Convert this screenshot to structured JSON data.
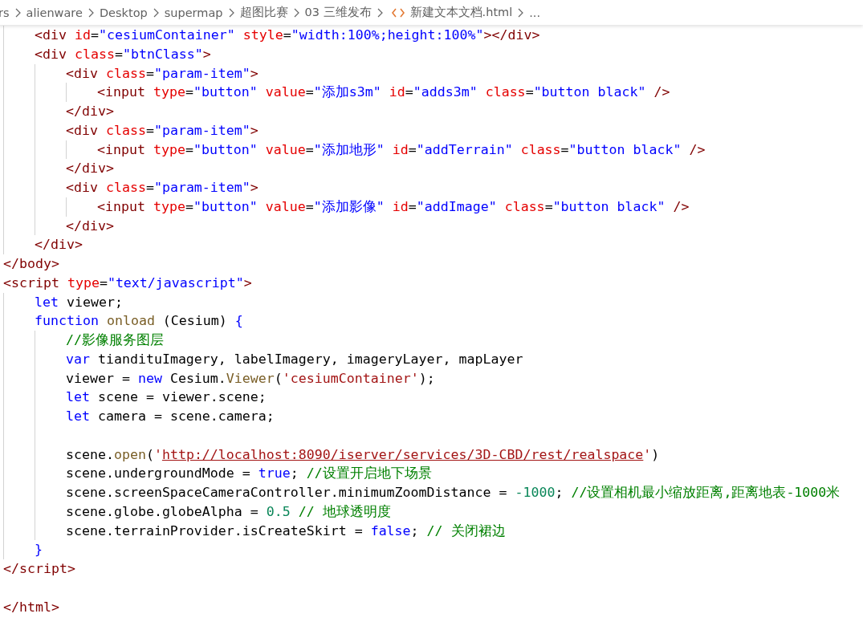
{
  "breadcrumb": [
    {
      "label": "rs",
      "kind": "folder"
    },
    {
      "label": "alienware",
      "kind": "folder"
    },
    {
      "label": "Desktop",
      "kind": "folder"
    },
    {
      "label": "supermap",
      "kind": "folder"
    },
    {
      "label": "超图比赛",
      "kind": "folder"
    },
    {
      "label": "03 三维发布",
      "kind": "folder"
    },
    {
      "label": "新建文本文档.html",
      "kind": "file"
    },
    {
      "label": "...",
      "kind": "more"
    }
  ],
  "code": [
    {
      "kind": "hidden",
      "children": [
        {
          "kind": "code",
          "tokens": [
            {
              "text": "<div",
              "kind": "tag"
            },
            {
              "text": " id",
              "kind": "attr"
            },
            {
              "text": "=",
              "kind": "plain"
            },
            {
              "text": "\"cesiumContainer\"",
              "kind": "value"
            },
            {
              "text": " style",
              "kind": "attr"
            },
            {
              "text": "=",
              "kind": "plain"
            },
            {
              "text": "\"width:100%;height:100%\"",
              "kind": "value"
            },
            {
              "text": "></div>",
              "kind": "tag"
            }
          ]
        },
        {
          "kind": "code",
          "tokens": [
            {
              "text": "<div",
              "kind": "tag"
            },
            {
              "text": " class",
              "kind": "attr"
            },
            {
              "text": "=",
              "kind": "plain"
            },
            {
              "text": "\"btnClass\"",
              "kind": "value"
            },
            {
              "text": ">",
              "kind": "tag"
            }
          ],
          "children": [
            {
              "kind": "code",
              "tokens": [
                {
                  "text": "<div",
                  "kind": "tag"
                },
                {
                  "text": " class",
                  "kind": "attr"
                },
                {
                  "text": "=",
                  "kind": "plain"
                },
                {
                  "text": "\"param-item\"",
                  "kind": "value"
                },
                {
                  "text": ">",
                  "kind": "tag"
                }
              ],
              "children": [
                {
                  "kind": "code",
                  "tokens": [
                    {
                      "text": "<input",
                      "kind": "tag"
                    },
                    {
                      "text": " type",
                      "kind": "attr"
                    },
                    {
                      "text": "=",
                      "kind": "plain"
                    },
                    {
                      "text": "\"button\"",
                      "kind": "value"
                    },
                    {
                      "text": " value",
                      "kind": "attr"
                    },
                    {
                      "text": "=",
                      "kind": "plain"
                    },
                    {
                      "text": "\"添加s3m\"",
                      "kind": "value"
                    },
                    {
                      "text": " id",
                      "kind": "attr"
                    },
                    {
                      "text": "=",
                      "kind": "plain"
                    },
                    {
                      "text": "\"adds3m\"",
                      "kind": "value"
                    },
                    {
                      "text": " class",
                      "kind": "attr"
                    },
                    {
                      "text": "=",
                      "kind": "plain"
                    },
                    {
                      "text": "\"button black\"",
                      "kind": "value"
                    },
                    {
                      "text": " />",
                      "kind": "tag"
                    }
                  ]
                }
              ]
            },
            {
              "kind": "code",
              "tokens": [
                {
                  "text": "</div>",
                  "kind": "tag"
                }
              ]
            },
            {
              "kind": "code",
              "tokens": [
                {
                  "text": "<div",
                  "kind": "tag"
                },
                {
                  "text": " class",
                  "kind": "attr"
                },
                {
                  "text": "=",
                  "kind": "plain"
                },
                {
                  "text": "\"param-item\"",
                  "kind": "value"
                },
                {
                  "text": ">",
                  "kind": "tag"
                }
              ],
              "children": [
                {
                  "kind": "code",
                  "tokens": [
                    {
                      "text": "<input",
                      "kind": "tag"
                    },
                    {
                      "text": " type",
                      "kind": "attr"
                    },
                    {
                      "text": "=",
                      "kind": "plain"
                    },
                    {
                      "text": "\"button\"",
                      "kind": "value"
                    },
                    {
                      "text": " value",
                      "kind": "attr"
                    },
                    {
                      "text": "=",
                      "kind": "plain"
                    },
                    {
                      "text": "\"添加地形\"",
                      "kind": "value"
                    },
                    {
                      "text": " id",
                      "kind": "attr"
                    },
                    {
                      "text": "=",
                      "kind": "plain"
                    },
                    {
                      "text": "\"addTerrain\"",
                      "kind": "value"
                    },
                    {
                      "text": " class",
                      "kind": "attr"
                    },
                    {
                      "text": "=",
                      "kind": "plain"
                    },
                    {
                      "text": "\"button black\"",
                      "kind": "value"
                    },
                    {
                      "text": " />",
                      "kind": "tag"
                    }
                  ]
                }
              ]
            },
            {
              "kind": "code",
              "tokens": [
                {
                  "text": "</div>",
                  "kind": "tag"
                }
              ]
            },
            {
              "kind": "code",
              "tokens": [
                {
                  "text": "<div",
                  "kind": "tag"
                },
                {
                  "text": " class",
                  "kind": "attr"
                },
                {
                  "text": "=",
                  "kind": "plain"
                },
                {
                  "text": "\"param-item\"",
                  "kind": "value"
                },
                {
                  "text": ">",
                  "kind": "tag"
                }
              ],
              "children": [
                {
                  "kind": "code",
                  "tokens": [
                    {
                      "text": "<input",
                      "kind": "tag"
                    },
                    {
                      "text": " type",
                      "kind": "attr"
                    },
                    {
                      "text": "=",
                      "kind": "plain"
                    },
                    {
                      "text": "\"button\"",
                      "kind": "value"
                    },
                    {
                      "text": " value",
                      "kind": "attr"
                    },
                    {
                      "text": "=",
                      "kind": "plain"
                    },
                    {
                      "text": "\"添加影像\"",
                      "kind": "value"
                    },
                    {
                      "text": " id",
                      "kind": "attr"
                    },
                    {
                      "text": "=",
                      "kind": "plain"
                    },
                    {
                      "text": "\"addImage\"",
                      "kind": "value"
                    },
                    {
                      "text": " class",
                      "kind": "attr"
                    },
                    {
                      "text": "=",
                      "kind": "plain"
                    },
                    {
                      "text": "\"button black\"",
                      "kind": "value"
                    },
                    {
                      "text": " />",
                      "kind": "tag"
                    }
                  ]
                }
              ]
            },
            {
              "kind": "code",
              "tokens": [
                {
                  "text": "</div>",
                  "kind": "tag"
                }
              ]
            }
          ]
        },
        {
          "kind": "code",
          "tokens": [
            {
              "text": "</div>",
              "kind": "tag"
            }
          ]
        }
      ]
    },
    {
      "kind": "code",
      "tokens": [
        {
          "text": "</body>",
          "kind": "tag"
        }
      ]
    },
    {
      "kind": "code",
      "tokens": [
        {
          "text": "<script",
          "kind": "tag"
        },
        {
          "text": " type",
          "kind": "attr"
        },
        {
          "text": "=",
          "kind": "plain"
        },
        {
          "text": "\"text/javascript\"",
          "kind": "value"
        },
        {
          "text": ">",
          "kind": "tag"
        }
      ],
      "children": [
        {
          "kind": "code",
          "tokens": [
            {
              "text": "let",
              "kind": "keyword"
            },
            {
              "text": " viewer;",
              "kind": "plain"
            }
          ]
        },
        {
          "kind": "code",
          "tokens": [
            {
              "text": "function",
              "kind": "keyword"
            },
            {
              "text": " onload",
              "kind": "function"
            },
            {
              "text": " (Cesium) ",
              "kind": "plain"
            },
            {
              "text": "{",
              "kind": "keyword"
            }
          ],
          "children": [
            {
              "kind": "code",
              "tokens": [
                {
                  "text": "//影像服务图层",
                  "kind": "comment"
                }
              ]
            },
            {
              "kind": "code",
              "tokens": [
                {
                  "text": "var",
                  "kind": "keyword"
                },
                {
                  "text": " tiandituImagery, labelImagery, imageryLayer, mapLayer",
                  "kind": "plain"
                }
              ]
            },
            {
              "kind": "code",
              "tokens": [
                {
                  "text": "viewer = ",
                  "kind": "plain"
                },
                {
                  "text": "new",
                  "kind": "keyword"
                },
                {
                  "text": " Cesium.",
                  "kind": "plain"
                },
                {
                  "text": "Viewer",
                  "kind": "function"
                },
                {
                  "text": "(",
                  "kind": "plain"
                },
                {
                  "text": "'cesiumContainer'",
                  "kind": "string"
                },
                {
                  "text": ");",
                  "kind": "plain"
                }
              ]
            },
            {
              "kind": "code",
              "tokens": [
                {
                  "text": "let",
                  "kind": "keyword"
                },
                {
                  "text": " scene = viewer.scene;",
                  "kind": "plain"
                }
              ]
            },
            {
              "kind": "code",
              "tokens": [
                {
                  "text": "let",
                  "kind": "keyword"
                },
                {
                  "text": " camera = scene.camera;",
                  "kind": "plain"
                }
              ]
            },
            {
              "kind": "blank"
            },
            {
              "kind": "code",
              "tokens": [
                {
                  "text": "scene.",
                  "kind": "plain"
                },
                {
                  "text": "open",
                  "kind": "function"
                },
                {
                  "text": "(",
                  "kind": "plain"
                },
                {
                  "text": "'",
                  "kind": "string"
                },
                {
                  "text": "http://localhost:8090/iserver/services/3D-CBD/rest/realspace",
                  "kind": "link"
                },
                {
                  "text": "'",
                  "kind": "string"
                },
                {
                  "text": ")",
                  "kind": "plain"
                }
              ]
            },
            {
              "kind": "code",
              "tokens": [
                {
                  "text": "scene.undergroundMode = ",
                  "kind": "plain"
                },
                {
                  "text": "true",
                  "kind": "keyword"
                },
                {
                  "text": "; ",
                  "kind": "plain"
                },
                {
                  "text": "//设置开启地下场景",
                  "kind": "comment"
                }
              ]
            },
            {
              "kind": "code",
              "tokens": [
                {
                  "text": "scene.screenSpaceCameraController.minimumZoomDistance = ",
                  "kind": "plain"
                },
                {
                  "text": "-1000",
                  "kind": "number"
                },
                {
                  "text": "; ",
                  "kind": "plain"
                },
                {
                  "text": "//设置相机最小缩放距离,距离地表-1000米",
                  "kind": "comment"
                }
              ]
            },
            {
              "kind": "code",
              "tokens": [
                {
                  "text": "scene.globe.globeAlpha = ",
                  "kind": "plain"
                },
                {
                  "text": "0.5",
                  "kind": "number"
                },
                {
                  "text": " // 地球透明度",
                  "kind": "comment"
                }
              ]
            },
            {
              "kind": "code",
              "tokens": [
                {
                  "text": "scene.terrainProvider.isCreateSkirt = ",
                  "kind": "plain"
                },
                {
                  "text": "false",
                  "kind": "keyword"
                },
                {
                  "text": "; ",
                  "kind": "plain"
                },
                {
                  "text": "// 关闭裙边",
                  "kind": "comment"
                }
              ]
            }
          ]
        },
        {
          "kind": "code",
          "tokens": [
            {
              "text": "}",
              "kind": "keyword"
            }
          ]
        }
      ]
    },
    {
      "kind": "code",
      "tokens": [
        {
          "text": "</script>",
          "kind": "tag"
        }
      ]
    },
    {
      "kind": "blank"
    },
    {
      "kind": "code",
      "tokens": [
        {
          "text": "</html>",
          "kind": "tag"
        }
      ]
    }
  ]
}
